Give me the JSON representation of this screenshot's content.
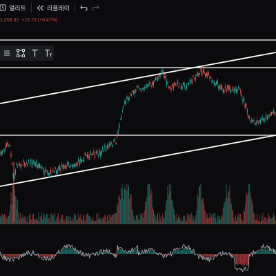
{
  "toolbar": {
    "alert_label": "얼리트",
    "replay_label": "리플레이",
    "icons": [
      "alert-clock-icon",
      "replay-rewind-icon",
      "undo-icon",
      "redo-icon"
    ]
  },
  "quote": {
    "price": "1,208.32",
    "change": "+15.73 (+0.47%)"
  },
  "drawing_toolbar": {
    "tools": [
      "drawing-menu-icon",
      "rectangle-select-icon",
      "text-tool-icon",
      "text-size-tool-icon"
    ]
  },
  "colors": {
    "background": "#0b0b0d",
    "up": "#26a69a",
    "down": "#ef5350",
    "trendline": "#ffffff",
    "oscillator_line": "#b2b5be",
    "price_change": "#c74a4a"
  }
}
